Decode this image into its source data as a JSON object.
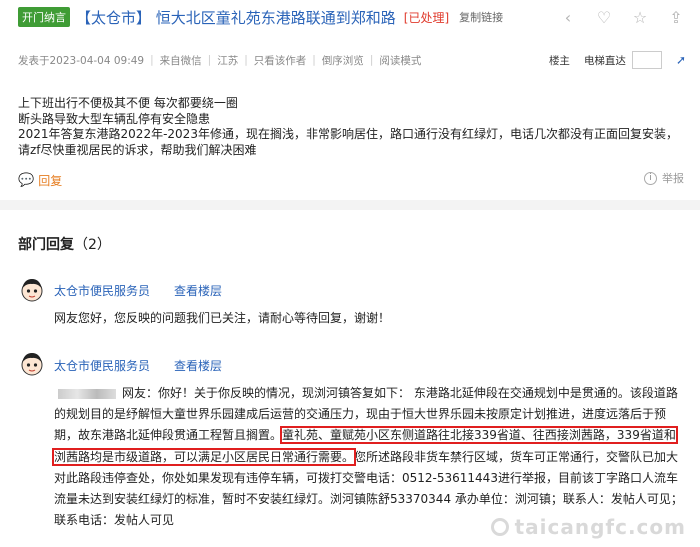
{
  "thread": {
    "open_tag": "开门纳言",
    "title": "【太仓市】 恒大北区童礼苑东港路联通到郑和路",
    "status": "[已处理]",
    "copy_link": "复制链接"
  },
  "meta": {
    "posted": "发表于2023-04-04 09:49",
    "source": "来自微信",
    "region": "江苏",
    "author_only": "只看该作者",
    "reverse": "倒序浏览",
    "reading_mode": "阅读模式",
    "owner": "楼主",
    "jump_label": "电梯直达"
  },
  "post": {
    "lines": [
      "上下班出行不便极其不便 每次都要绕一圈",
      "断头路导致大型车辆乱停有安全隐患",
      "2021年答复东港路2022年-2023年修通，现在搁浅，非常影响居住，路口通行没有红绿灯，电话几次都没有正面回复安装，",
      "请zf尽快重视居民的诉求，帮助我们解决困难"
    ],
    "reply_label": "回复",
    "report_label": "举报"
  },
  "dept": {
    "header": "部门回复",
    "count": "（2）",
    "replies": [
      {
        "name": "太仓市便民服务员",
        "view_floor": "查看楼层",
        "text": "网友您好，您反映的问题我们已关注，请耐心等待回复，谢谢！"
      },
      {
        "name": "太仓市便民服务员",
        "view_floor": "查看楼层",
        "prefix": "网友：",
        "text_a": "你好！关于你反映的情况，现浏河镇答复如下： 东港路北延伸段在交通规划中是贯通的。该段道路的规划目的是纾解恒大童世界乐园建成后运营的交通压力，现由于恒大世界乐园未按原定计划推进，进度远落后于预期，故东港路北延伸段贯通工程暂且搁置。",
        "text_highlight": "童礼苑、童赋苑小区东侧道路往北接339省道、往西接浏茜路，339省道和浏茜路均是市级道路，可以满足小区居民日常通行需要。",
        "text_b": "您所述路段非货车禁行区域，货车可正常通行，交警队已加大对此路段违停查处，你处如果发现有违停车辆，可拨打交警电话：0512-53611443进行举报，目前该丁字路口人流车流量未达到安装红绿灯的标准，暂时不安装红绿灯。浏河镇陈舒53370344 承办单位：浏河镇；联系人：发帖人可见；联系电话：发帖人可见"
      }
    ]
  },
  "watermark": "taicangfc.com",
  "colors": {
    "link": "#2a63b8",
    "status": "#e03b2d",
    "highlight": "#e01f1f",
    "open_tag": "#3f9c35",
    "reply": "#e67e22"
  }
}
